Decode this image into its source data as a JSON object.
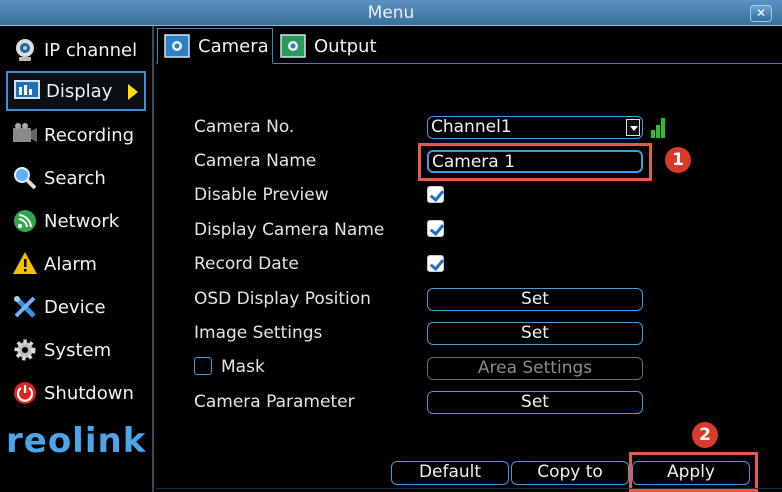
{
  "window": {
    "title": "Menu",
    "close_icon": "close-icon"
  },
  "sidebar": {
    "items": [
      {
        "label": "IP channel",
        "icon": "webcam-icon"
      },
      {
        "label": "Display",
        "icon": "monitor-icon",
        "active": true
      },
      {
        "label": "Recording",
        "icon": "film-icon"
      },
      {
        "label": "Search",
        "icon": "magnifier-icon"
      },
      {
        "label": "Network",
        "icon": "network-icon"
      },
      {
        "label": "Alarm",
        "icon": "warning-icon"
      },
      {
        "label": "Device",
        "icon": "tools-icon"
      },
      {
        "label": "System",
        "icon": "gear-icon"
      },
      {
        "label": "Shutdown",
        "icon": "power-icon"
      }
    ],
    "logo": "reolink"
  },
  "tabs": [
    {
      "label": "Camera",
      "active": true
    },
    {
      "label": "Output",
      "active": false
    }
  ],
  "form": {
    "camera_no": {
      "label": "Camera No.",
      "value": "Channel1"
    },
    "camera_name": {
      "label": "Camera Name",
      "value": "Camera 1"
    },
    "disable_preview": {
      "label": "Disable Preview",
      "checked": true
    },
    "display_camera_name": {
      "label": "Display Camera Name",
      "checked": true
    },
    "record_date": {
      "label": "Record Date",
      "checked": true
    },
    "osd_display_position": {
      "label": "OSD Display Position",
      "button": "Set"
    },
    "image_settings": {
      "label": "Image Settings",
      "button": "Set"
    },
    "mask": {
      "label": "Mask",
      "checked": false,
      "button": "Area Settings"
    },
    "camera_parameter": {
      "label": "Camera Parameter",
      "button": "Set"
    }
  },
  "footer": {
    "default_label": "Default",
    "copy_to_label": "Copy to",
    "apply_label": "Apply"
  },
  "annotations": [
    "1",
    "2"
  ],
  "colors": {
    "accent": "#3f9be0",
    "annotation": "#e25b4b",
    "signal": "#29c22e"
  }
}
